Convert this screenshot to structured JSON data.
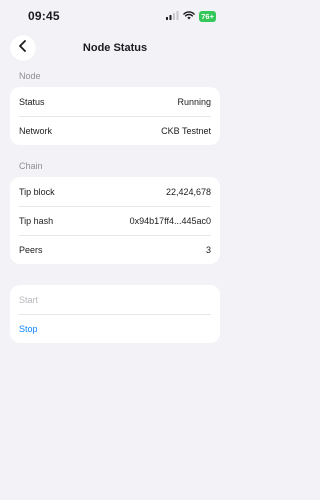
{
  "status_bar": {
    "time": "09:45",
    "battery": "76+",
    "icons": [
      "signal-icon",
      "wifi-icon",
      "battery-icon"
    ]
  },
  "header": {
    "title": "Node Status",
    "back_icon": "chevron-left-icon"
  },
  "sections": {
    "node": {
      "label": "Node",
      "rows": [
        {
          "label": "Status",
          "value": "Running"
        },
        {
          "label": "Network",
          "value": "CKB Testnet"
        }
      ]
    },
    "chain": {
      "label": "Chain",
      "rows": [
        {
          "label": "Tip block",
          "value": "22,424,678"
        },
        {
          "label": "Tip hash",
          "value": "0x94b17ff4...445ac0"
        },
        {
          "label": "Peers",
          "value": "3"
        }
      ]
    }
  },
  "actions": {
    "start_label": "Start",
    "stop_label": "Stop"
  },
  "colors": {
    "background": "#f2f2f7",
    "accent": "#0a84ff",
    "disabled": "#b8b8bd",
    "battery": "#34c759"
  }
}
